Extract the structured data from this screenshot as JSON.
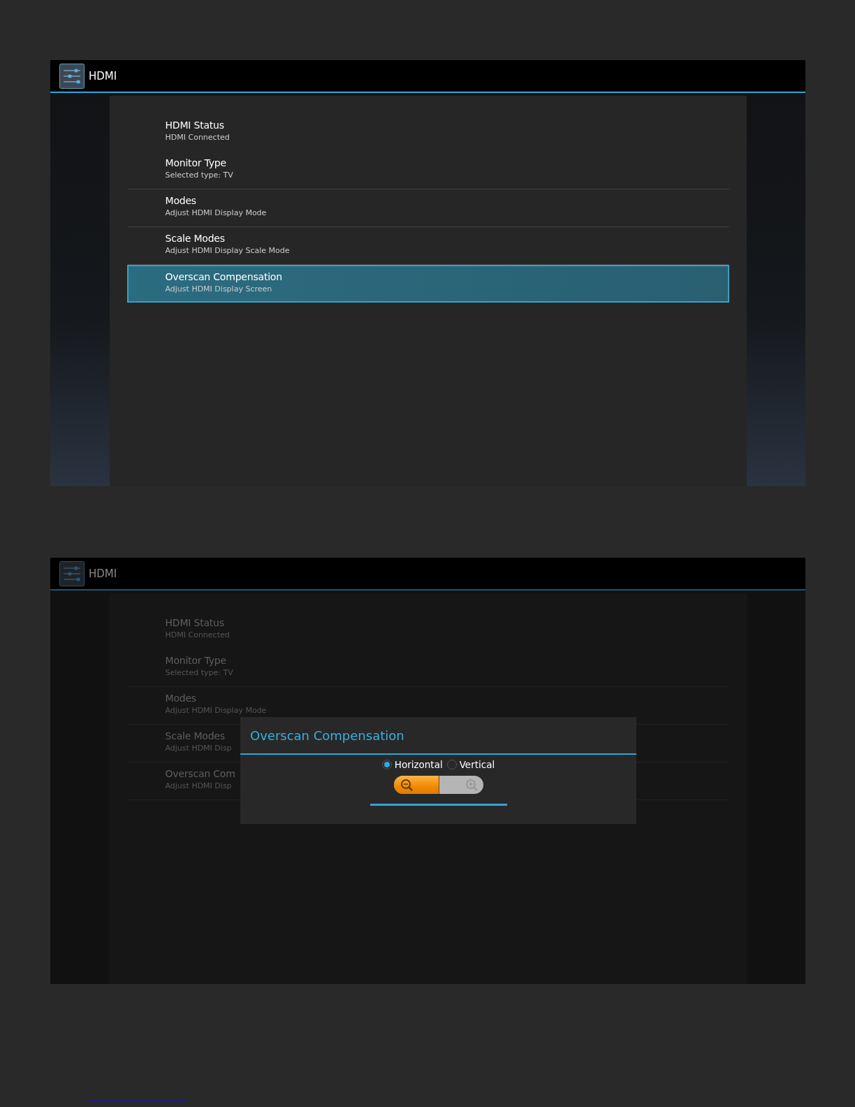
{
  "screens": [
    {
      "title": "HDMI",
      "dimmed": false,
      "items": [
        {
          "title": "HDMI Status",
          "subtitle": "HDMI Connected",
          "selected": false
        },
        {
          "title": "Monitor Type",
          "subtitle": "Selected type: TV",
          "selected": false
        },
        {
          "title": "Modes",
          "subtitle": "Adjust HDMI Display Mode",
          "selected": false
        },
        {
          "title": "Scale Modes",
          "subtitle": "Adjust HDMI Display Scale Mode",
          "selected": false
        },
        {
          "title": "Overscan Compensation",
          "subtitle": "Adjust HDMI Display Screen",
          "selected": true
        }
      ]
    },
    {
      "title": "HDMI",
      "dimmed": true,
      "items": [
        {
          "title": "HDMI Status",
          "subtitle": "HDMI Connected",
          "selected": false
        },
        {
          "title": "Monitor Type",
          "subtitle": "Selected type: TV",
          "selected": false
        },
        {
          "title": "Modes",
          "subtitle": "Adjust HDMI Display Mode",
          "selected": false
        },
        {
          "title": "Scale Modes",
          "subtitle": "Adjust HDMI Disp",
          "selected": false
        },
        {
          "title": "Overscan Com",
          "subtitle": "Adjust HDMI Disp",
          "selected": false
        }
      ],
      "dialog": {
        "title": "Overscan Compensation",
        "options": [
          {
            "label": "Horizontal",
            "selected": true
          },
          {
            "label": "Vertical",
            "selected": false
          }
        ],
        "zoom": {
          "level": 0.5
        }
      }
    }
  ]
}
